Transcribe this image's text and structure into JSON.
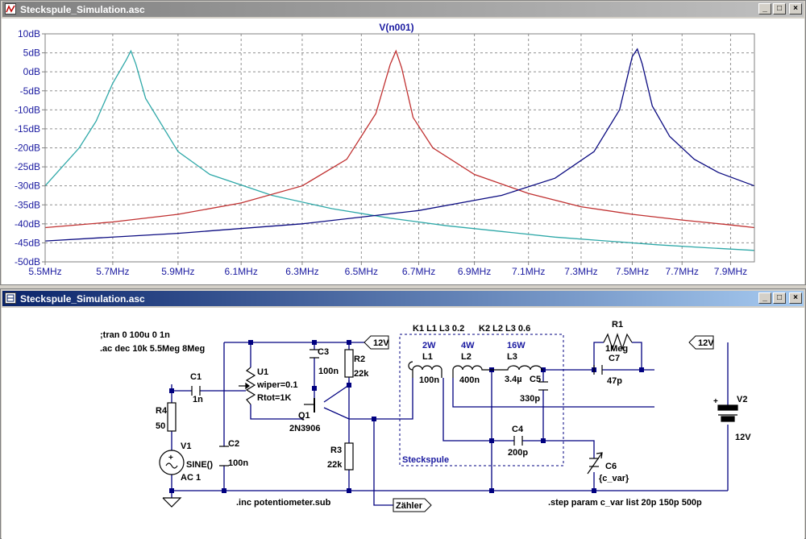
{
  "plot_window": {
    "title": "Steckspule_Simulation.asc",
    "buttons": {
      "minimize": "_",
      "restore": "□",
      "close": "×"
    }
  },
  "chart_data": {
    "type": "line",
    "title": "V(n001)",
    "x_scale": "log",
    "xlim": [
      5.5,
      8.0
    ],
    "ylim": [
      -50,
      10
    ],
    "x_ticks": [
      "5.5MHz",
      "5.7MHz",
      "5.9MHz",
      "6.1MHz",
      "6.3MHz",
      "6.5MHz",
      "6.7MHz",
      "6.9MHz",
      "7.1MHz",
      "7.3MHz",
      "7.5MHz",
      "7.7MHz",
      "7.9MHz"
    ],
    "y_ticks": [
      "10dB",
      "5dB",
      "0dB",
      "-5dB",
      "-10dB",
      "-15dB",
      "-20dB",
      "-25dB",
      "-30dB",
      "-35dB",
      "-40dB",
      "-45dB",
      "-50dB"
    ],
    "grid": true,
    "series": [
      {
        "color": "#2ea8a8",
        "x": [
          5.5,
          5.6,
          5.65,
          5.7,
          5.72,
          5.74,
          5.755,
          5.77,
          5.8,
          5.9,
          6.0,
          6.2,
          6.4,
          6.6,
          6.8,
          7.0,
          7.2,
          7.4,
          7.6,
          7.8,
          8.0
        ],
        "y": [
          -30,
          -20,
          -13,
          -3,
          0,
          3,
          5.5,
          2,
          -7,
          -21,
          -27,
          -32.5,
          -36,
          -38.5,
          -40.5,
          -42,
          -43.5,
          -44.5,
          -45.5,
          -46.3,
          -47
        ]
      },
      {
        "color": "#c03030",
        "x": [
          5.5,
          5.7,
          5.9,
          6.1,
          6.3,
          6.45,
          6.55,
          6.6,
          6.62,
          6.64,
          6.68,
          6.75,
          6.9,
          7.1,
          7.3,
          7.5,
          7.7,
          7.9,
          8.0
        ],
        "y": [
          -41,
          -39.5,
          -37.5,
          -34.5,
          -30,
          -23,
          -11,
          2,
          5.5,
          1,
          -12,
          -20,
          -27,
          -32,
          -35.5,
          -37.5,
          -39,
          -40.3,
          -41
        ]
      },
      {
        "color": "#0a0a80",
        "x": [
          5.5,
          5.9,
          6.3,
          6.7,
          7.0,
          7.2,
          7.35,
          7.45,
          7.5,
          7.52,
          7.54,
          7.58,
          7.65,
          7.75,
          7.85,
          8.0
        ],
        "y": [
          -44.5,
          -42.5,
          -40,
          -36.5,
          -32.5,
          -28,
          -21,
          -10,
          4,
          6,
          2,
          -9,
          -17,
          -23,
          -26.5,
          -30
        ]
      }
    ]
  },
  "schematic_window": {
    "title": "Steckspule_Simulation.asc",
    "buttons": {
      "minimize": "_",
      "restore": "□",
      "close": "×"
    }
  },
  "schematic": {
    "directives": {
      "tran": ";tran 0 100u 0 1n",
      "ac": ".ac dec 10k 5.5Meg 8Meg",
      "inc": ".inc potentiometer.sub",
      "step": ".step param c_var list 20p 150p 500p"
    },
    "coupling": {
      "k1": "K1 L1 L3 0.2",
      "k2": "K2 L2 L3 0.6"
    },
    "box_label": "Steckspule",
    "winding": {
      "l1": "2W",
      "l2": "4W",
      "l3": "16W"
    },
    "components": {
      "r4": {
        "name": "R4",
        "value": "50"
      },
      "v1": {
        "name": "V1",
        "value": "SINE()",
        "ac": "AC 1"
      },
      "c1": {
        "name": "C1",
        "value": "1n"
      },
      "c2": {
        "name": "C2",
        "value": "100n"
      },
      "u1": {
        "name": "U1",
        "p1": "wiper=0.1",
        "p2": "Rtot=1K"
      },
      "c3": {
        "name": "C3",
        "value": "100n"
      },
      "q1": {
        "name": "Q1",
        "value": "2N3906"
      },
      "r2": {
        "name": "R2",
        "value": "22k"
      },
      "r3": {
        "name": "R3",
        "value": "22k"
      },
      "l1": {
        "name": "L1",
        "value": "100n"
      },
      "l2": {
        "name": "L2",
        "value": "400n"
      },
      "l3": {
        "name": "L3",
        "value": "3.4µ"
      },
      "c5": {
        "name": "C5",
        "value": "330p"
      },
      "c4": {
        "name": "C4",
        "value": "200p"
      },
      "c6": {
        "name": "C6",
        "value": "{c_var}"
      },
      "r1": {
        "name": "R1",
        "value": "1Meg"
      },
      "c7": {
        "name": "C7",
        "value": "47p"
      },
      "v2": {
        "name": "V2",
        "value": "12V"
      }
    },
    "net_labels": {
      "vcc1": "12V",
      "vcc2": "12V",
      "counter": "Zähler"
    }
  }
}
